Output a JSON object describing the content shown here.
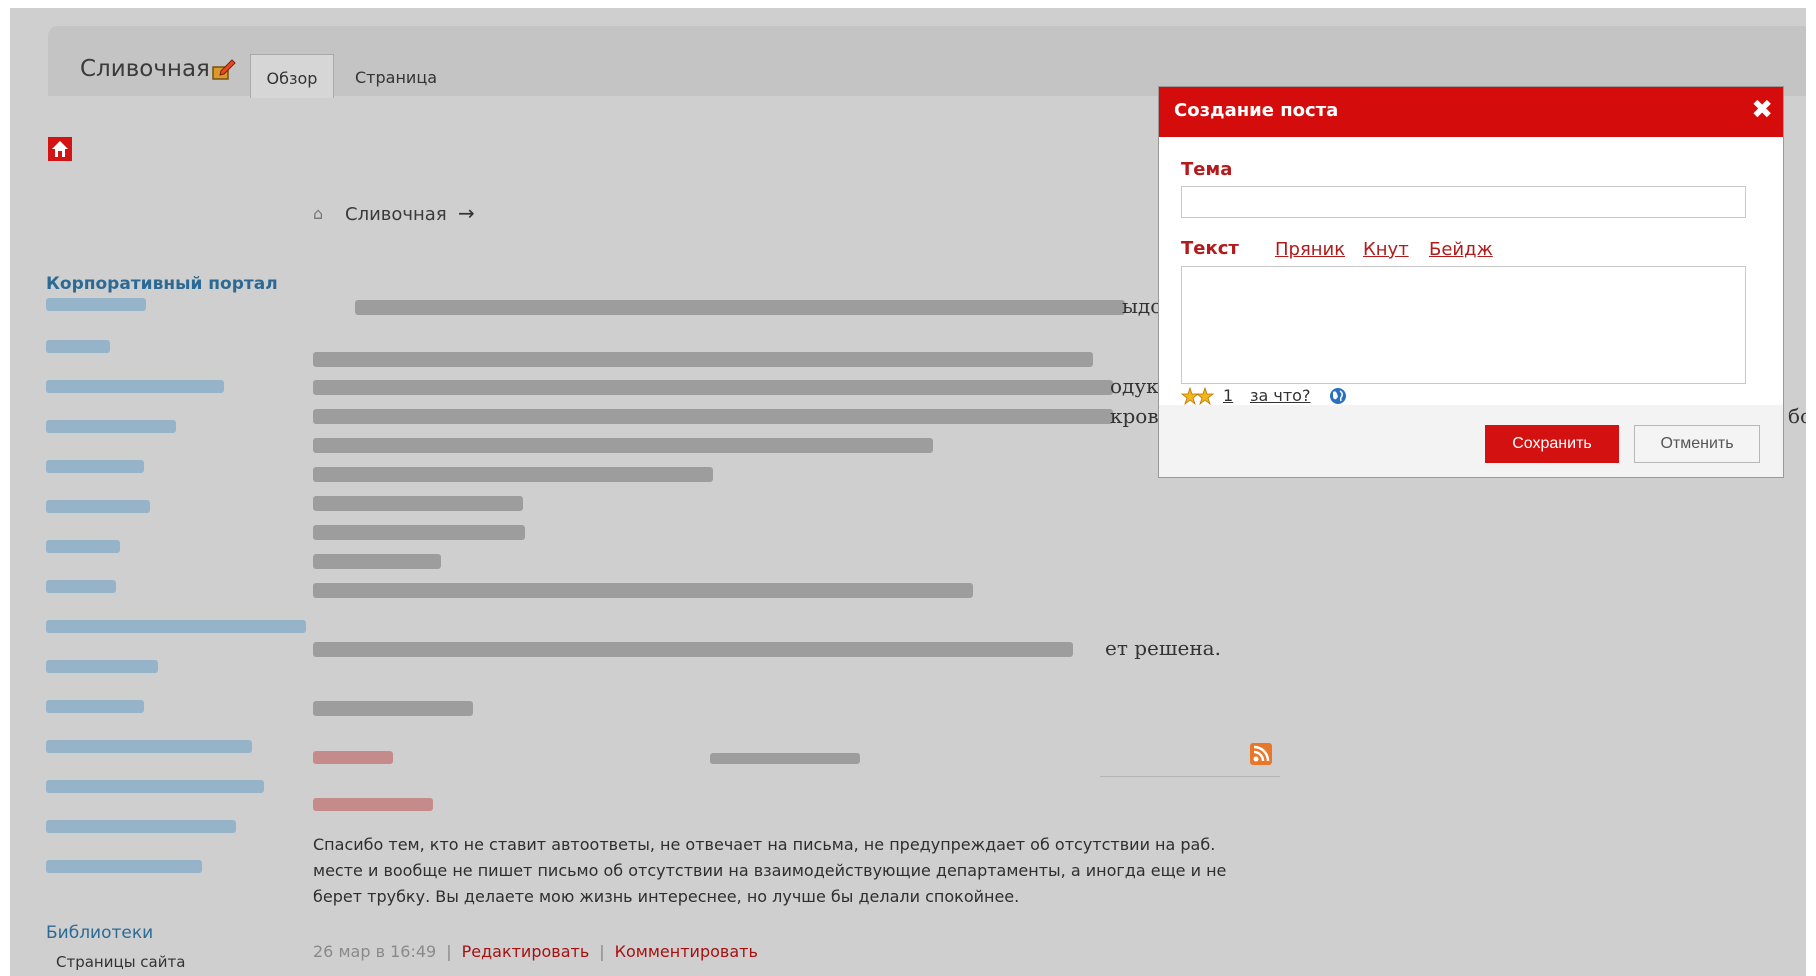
{
  "header": {
    "site_name": "Сливочная",
    "tabs": [
      {
        "label": "Обзор",
        "active": true
      },
      {
        "label": "Страница",
        "active": false
      }
    ]
  },
  "breadcrumb": {
    "text": "Сливочная",
    "arrow": "→"
  },
  "sidebar": {
    "title": "Корпоративный портал",
    "libraries_title": "Библиотеки",
    "libraries_item": "Страницы сайта"
  },
  "main": {
    "visible_fragments": [
      "ыдо",
      "одук",
      "кров",
      "бок",
      "ет решена."
    ],
    "post": {
      "body": "Спасибо тем, кто не ставит автоответы, не отвечает на письма, не предупреждает об отсутствии на раб. месте и вообще не пишет письмо об отсутствии на взаимодействующие департаменты, а иногда еще и не берет трубку. Вы делаете мою жизнь интереснее, но лучше бы делали спокойнее.",
      "date": "26 мар в 16:49",
      "edit_label": "Редактировать",
      "comment_label": "Комментировать",
      "separator": "|"
    }
  },
  "dialog": {
    "title": "Создание поста",
    "close_label": "✖",
    "subject_label": "Тема",
    "subject_value": "",
    "text_label": "Текст",
    "links": [
      "Пряник",
      "Кнут",
      "Бейдж"
    ],
    "text_value": "",
    "emotion_count": "1",
    "emotion_why": "за что?",
    "save_label": "Сохранить",
    "cancel_label": "Отменить"
  },
  "colors": {
    "accent_red": "#d50c0c",
    "link_blue": "#2b6a95",
    "overlay_gray": "#cfcfcf"
  },
  "icons": [
    "edit-icon",
    "home-icon",
    "breadcrumb-home-icon",
    "rss-feed-icon",
    "close-icon",
    "emotion-icon",
    "globe-icon"
  ]
}
